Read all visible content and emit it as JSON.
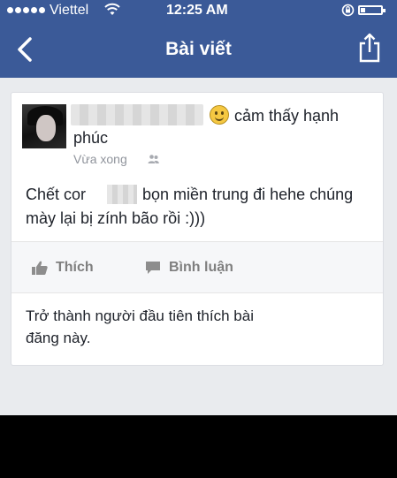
{
  "status_bar": {
    "carrier": "Viettel",
    "time": "12:25 AM"
  },
  "nav": {
    "title": "Bài viết",
    "back_icon": "chevron-left-icon",
    "share_icon": "share-icon"
  },
  "post": {
    "feeling_line1": "cảm thấy hạnh",
    "feeling_line2": "phúc",
    "timestamp": "Vừa xong",
    "body_line1_start": "Chết cor",
    "body_line1_end": "bọn miền trung đi hehe chúng",
    "body_line2": "mày lại bị zính bão rồi :)))"
  },
  "actions": {
    "like_label": "Thích",
    "comment_label": "Bình luận"
  },
  "likes": {
    "line1": "Trở thành người đầu tiên thích bài",
    "line2": "đăng này."
  },
  "colors": {
    "header_blue": "#3b5a98",
    "background": "#e9ebee",
    "text": "#1d2129",
    "muted": "#90949c"
  }
}
